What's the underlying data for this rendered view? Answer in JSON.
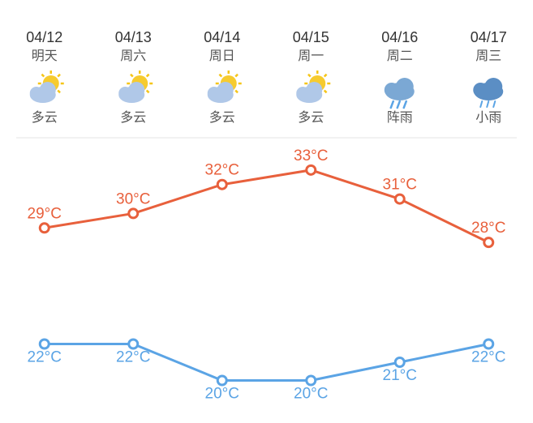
{
  "days": [
    {
      "date": "04/12",
      "name": "明天",
      "desc": "多云",
      "icon": "partly_cloudy",
      "high": 29,
      "low": 22
    },
    {
      "date": "04/13",
      "name": "周六",
      "desc": "多云",
      "icon": "partly_cloudy",
      "high": 30,
      "low": 22
    },
    {
      "date": "04/14",
      "name": "周日",
      "desc": "多云",
      "icon": "partly_cloudy",
      "high": 32,
      "low": 20
    },
    {
      "date": "04/15",
      "name": "周一",
      "desc": "多云",
      "icon": "partly_cloudy",
      "high": 33,
      "low": 20
    },
    {
      "date": "04/16",
      "name": "周二",
      "desc": "阵雨",
      "icon": "rain",
      "high": 31,
      "low": 21
    },
    {
      "date": "04/17",
      "name": "周三",
      "desc": "小雨",
      "icon": "light_rain",
      "high": 28,
      "low": 22
    }
  ],
  "highColor": "#E8603C",
  "lowColor": "#5BA4E5",
  "dotRadius": 5
}
